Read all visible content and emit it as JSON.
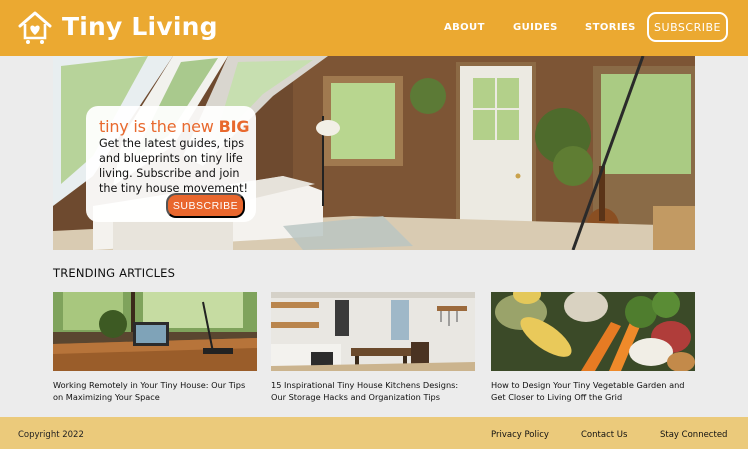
{
  "header": {
    "brand": "Tiny Living",
    "logo_icon": "house-heart-icon",
    "nav": [
      {
        "label": "ABOUT"
      },
      {
        "label": "GUIDES"
      },
      {
        "label": "STORIES"
      }
    ],
    "subscribe_label": "SUBSCRIBE"
  },
  "hero": {
    "headline_prefix": "tiny is the new ",
    "headline_emphasis": "BIG",
    "body": "Get the latest guides, tips and blueprints on tiny life living. Subscribe and join the tiny house movement!",
    "cta_label": "SUBSCRIBE"
  },
  "trending": {
    "title": "TRENDING ARTICLES",
    "articles": [
      {
        "title": "Working Remotely in Your Tiny House: Our Tips on Maximizing Your Space"
      },
      {
        "title": "15 Inspirational Tiny House Kitchens Designs: Our Storage Hacks and Organization Tips"
      },
      {
        "title": "How to Design Your Tiny Vegetable Garden and Get Closer to Living Off the Grid"
      }
    ]
  },
  "footer": {
    "copyright": "Copyright 2022",
    "links": [
      {
        "label": "Privacy Policy"
      },
      {
        "label": "Contact Us"
      },
      {
        "label": "Stay Connected"
      }
    ]
  },
  "colors": {
    "header_bg": "#eba931",
    "accent_orange": "#e9672d",
    "footer_bg": "#ebca7b",
    "page_bg": "#ececec"
  }
}
